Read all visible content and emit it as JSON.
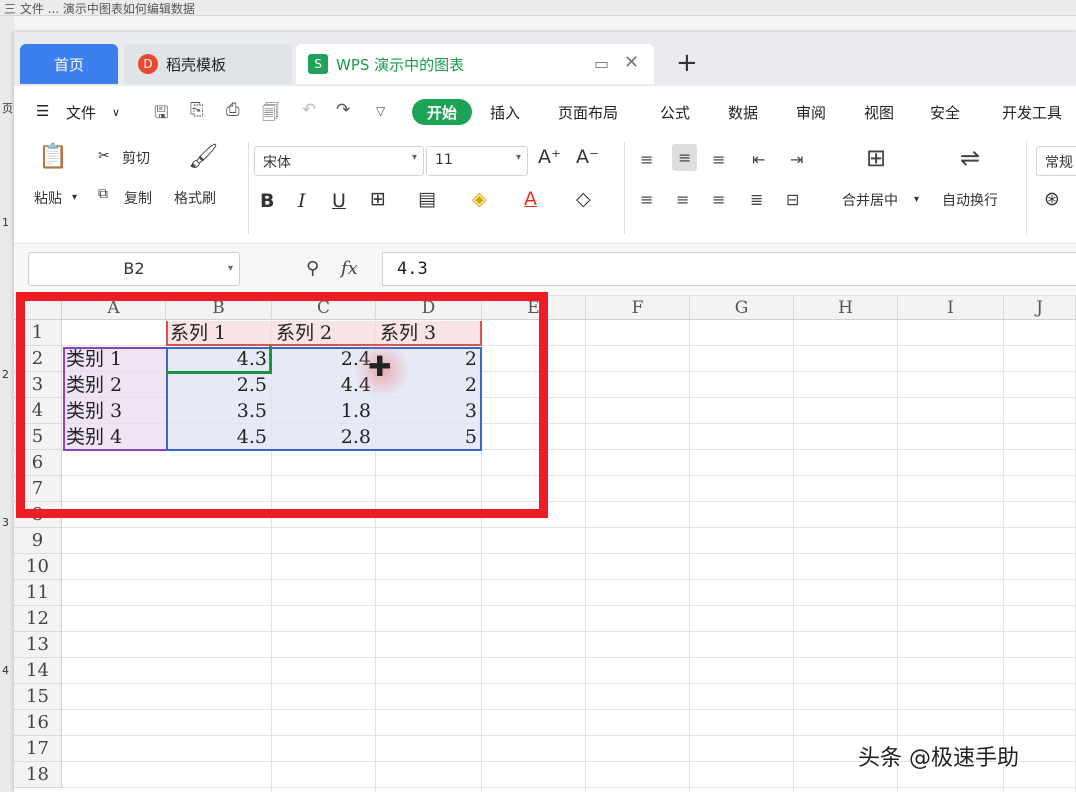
{
  "background": {
    "top_text": "三 文件 ... 演示中图表如何编辑数据",
    "left_labels": [
      "页",
      "1",
      "2",
      "3",
      "4"
    ]
  },
  "tabs": {
    "home": "首页",
    "templates": "稻壳模板",
    "doc": "WPS 演示中的图表",
    "new_tab_icon": "plus-icon"
  },
  "menu": {
    "file": "文件",
    "start": "开始",
    "items": [
      "插入",
      "页面布局",
      "公式",
      "数据",
      "审阅",
      "视图",
      "安全",
      "开发工具"
    ]
  },
  "ribbon": {
    "paste": "粘贴",
    "cut": "剪切",
    "copy": "复制",
    "format_painter": "格式刷",
    "font_name": "宋体",
    "font_size": "11",
    "merge_center": "合并居中",
    "wrap_text": "自动换行",
    "number_format": "常规"
  },
  "formula_bar": {
    "name_box": "B2",
    "fx": "fx",
    "value": "4.3"
  },
  "sheet": {
    "columns": [
      "A",
      "B",
      "C",
      "D",
      "E",
      "F",
      "G",
      "H",
      "I",
      "J"
    ],
    "rows": [
      "1",
      "2",
      "3",
      "4",
      "5",
      "6",
      "7",
      "8",
      "9",
      "10",
      "11",
      "12",
      "13",
      "14",
      "15",
      "16",
      "17",
      "18"
    ],
    "header_row": [
      "",
      "系列 1",
      "系列 2",
      "系列 3"
    ],
    "data_rows": [
      [
        "类别 1",
        "4.3",
        "2.4",
        "2"
      ],
      [
        "类别 2",
        "2.5",
        "4.4",
        "2"
      ],
      [
        "类别 3",
        "3.5",
        "1.8",
        "3"
      ],
      [
        "类别 4",
        "4.5",
        "2.8",
        "5"
      ]
    ]
  },
  "watermark": "头条 @极速手助",
  "colors": {
    "accent_green": "#1da256",
    "home_tab": "#3e7ff0",
    "highlight_red": "#ee1c25"
  }
}
